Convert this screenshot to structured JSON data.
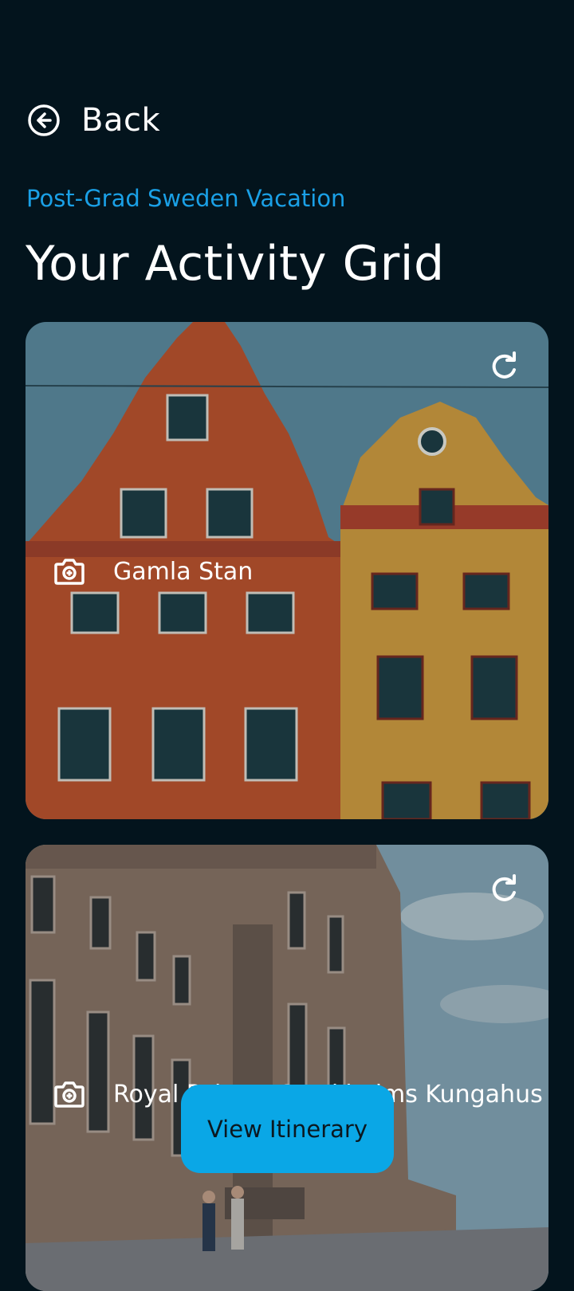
{
  "nav": {
    "back_label": "Back",
    "back_icon": "arrow-left-circle-icon"
  },
  "header": {
    "trip_name": "Post-Grad Sweden Vacation",
    "title": "Your Activity Grid"
  },
  "colors": {
    "background": "#03141d",
    "accent": "#1aa0e6",
    "button": "#0aa7e6"
  },
  "activities": [
    {
      "title": "Gamla Stan",
      "icon": "camera-icon",
      "action_icon": "refresh-icon"
    },
    {
      "title": "Royal Palace: Stockholms Kungahus",
      "icon": "camera-icon",
      "action_icon": "refresh-icon"
    }
  ],
  "fab": {
    "label": "View Itinerary"
  }
}
